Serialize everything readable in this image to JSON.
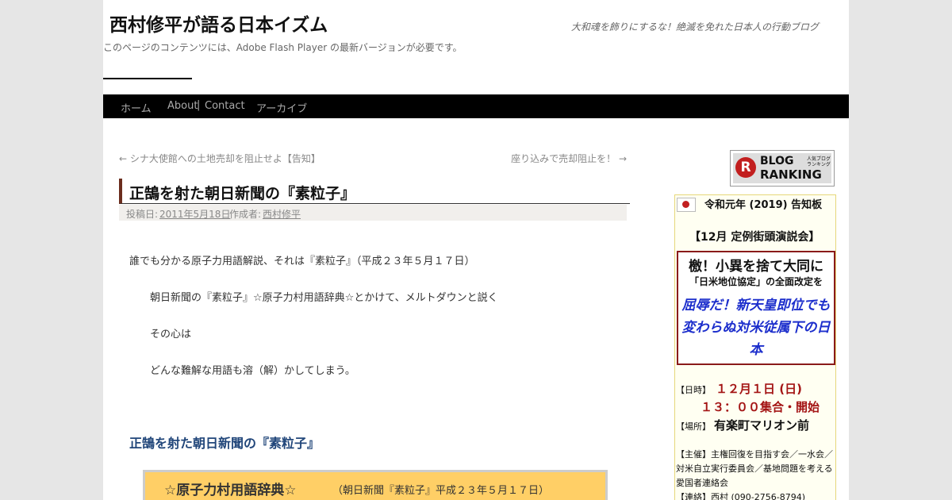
{
  "header": {
    "site_title": "西村修平が語る日本イズム",
    "site_description": "大和魂を飾りにするな！絶滅を免れた日本人の行動ブログ",
    "flash_note": "このページのコンテンツには、Adobe Flash Player の最新バージョンが必要です。"
  },
  "nav": {
    "items": [
      "ホーム",
      "About",
      "Contact",
      "アーカイブ"
    ],
    "separator": "|"
  },
  "post_nav": {
    "prev": "← シナ大使館への土地売却を阻止せよ【告知】",
    "next": "座り込みで売却阻止を！ →"
  },
  "post": {
    "title": "正鵠を射た朝日新聞の『素粒子』",
    "meta_posted_label": "投稿日:",
    "meta_date": "2011年5月18日",
    "meta_author_label": "作成者:",
    "meta_author": "西村修平",
    "paragraphs": [
      "誰でも分かる原子力用語解説、それは『素粒子』（平成２３年５月１７日）",
      "朝日新聞の『素粒子』☆原子力村用語辞典☆とかけて、メルトダウンと説く",
      "その心は",
      "どんな難解な用語も溶（解）かしてしまう。"
    ],
    "subheading": "正鵠を射た朝日新聞の『素粒子』",
    "dict_title": "☆原子力村用語辞典☆",
    "dict_source": "（朝日新聞『素粒子』平成２３年５月１７日）"
  },
  "banner": {
    "logo_letter": "R",
    "line1": "BLOG",
    "line2": "RANKING",
    "tag": "人気ブログランキング"
  },
  "sidebar": {
    "notice_title": "令和元年 (2019) 告知板",
    "event_title": "【12月 定例街頭演説会】",
    "box_line1": "檄！小異を捨て大同に",
    "box_line2": "「日米地位協定」の全面改定を",
    "box_line3": "屈辱だ！新天皇即位でも変わらぬ対米従属下の日本",
    "date_label": "【日時】",
    "date_value": "１２月１日 (日)",
    "time_value": "１３：００集合・開始",
    "place_label": "【場所】",
    "place_value": "有楽町マリオン前",
    "organizer": "【主催】主権回復を目指す会／一水会／対米自立実行委員会／基地問題を考える愛国者連絡会",
    "contact": "【連絡】西村 (090-2756-8794)"
  },
  "colors": {
    "nav_bg": "#000000",
    "title_accent": "#6b2d1e",
    "subheading": "#21467a",
    "dict_bg": "#ffcf66",
    "sidebar_red": "#a41515",
    "sidebar_blue": "#1c2ecc"
  },
  "icons": {
    "flag": "japan-flag-icon",
    "ranking": "blog-ranking-logo"
  }
}
